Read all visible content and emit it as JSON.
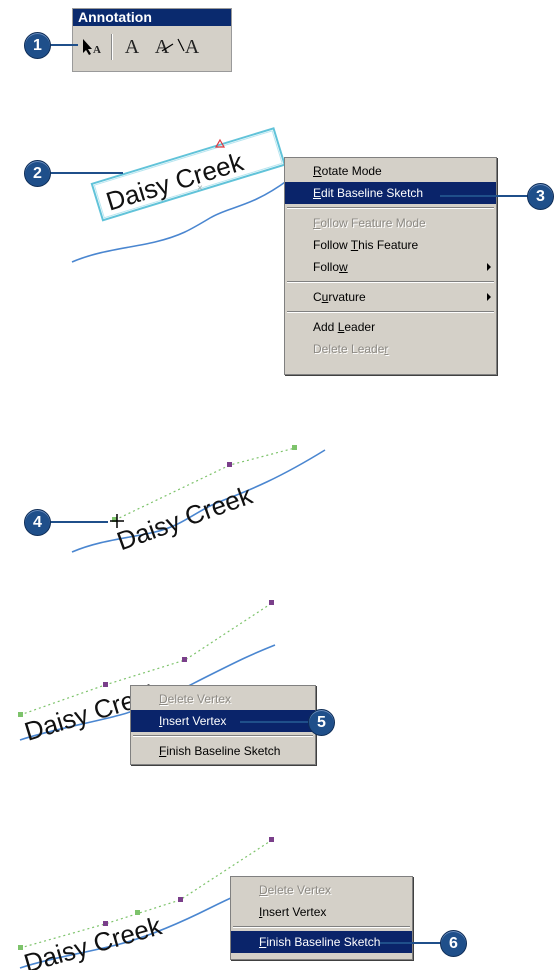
{
  "toolbar": {
    "title": "Annotation",
    "buttons": [
      {
        "icon": "select-annotation-icon",
        "label": "A"
      },
      {
        "icon": "horizontal-text-icon",
        "label": "A"
      },
      {
        "icon": "curved-text-icon",
        "label": "A"
      },
      {
        "icon": "follow-feature-text-icon",
        "label": "A"
      }
    ]
  },
  "callouts": [
    "1",
    "2",
    "3",
    "4",
    "5",
    "6"
  ],
  "label_text": "Daisy Creek",
  "context_menu_1": {
    "items": [
      {
        "label": "Rotate Mode",
        "accel": "R",
        "state": "normal"
      },
      {
        "label": "Edit Baseline Sketch",
        "accel": "E",
        "state": "selected"
      },
      {
        "label": "Follow Feature Mode",
        "accel": "F",
        "state": "disabled"
      },
      {
        "label": "Follow This Feature",
        "accel": "T",
        "state": "normal"
      },
      {
        "label": "Follow",
        "accel": "w",
        "state": "normal",
        "submenu": true
      },
      {
        "label": "Curvature",
        "accel": "u",
        "state": "normal",
        "submenu": true
      },
      {
        "label": "Add Leader",
        "accel": "L",
        "state": "normal"
      },
      {
        "label": "Delete Leader",
        "accel": "r",
        "state": "disabled"
      }
    ]
  },
  "context_menu_2": {
    "items": [
      {
        "label": "Delete Vertex",
        "accel": "D",
        "state": "disabled"
      },
      {
        "label": "Insert Vertex",
        "accel": "I",
        "state": "selected"
      },
      {
        "label": "Finish Baseline Sketch",
        "accel": "F",
        "state": "normal"
      }
    ]
  },
  "context_menu_3": {
    "items": [
      {
        "label": "Delete Vertex",
        "accel": "D",
        "state": "disabled"
      },
      {
        "label": "Insert Vertex",
        "accel": "I",
        "state": "normal"
      },
      {
        "label": "Finish Baseline Sketch",
        "accel": "F",
        "state": "selected"
      }
    ]
  },
  "colors": {
    "callout": "#1f4f8a",
    "menu_bg": "#d4d0c8",
    "highlight": "#0a246a",
    "river": "#4a86d0",
    "baseline": "#7dc36b",
    "vertex": "#7a3f8a",
    "selection_box": "#61c3d9"
  }
}
